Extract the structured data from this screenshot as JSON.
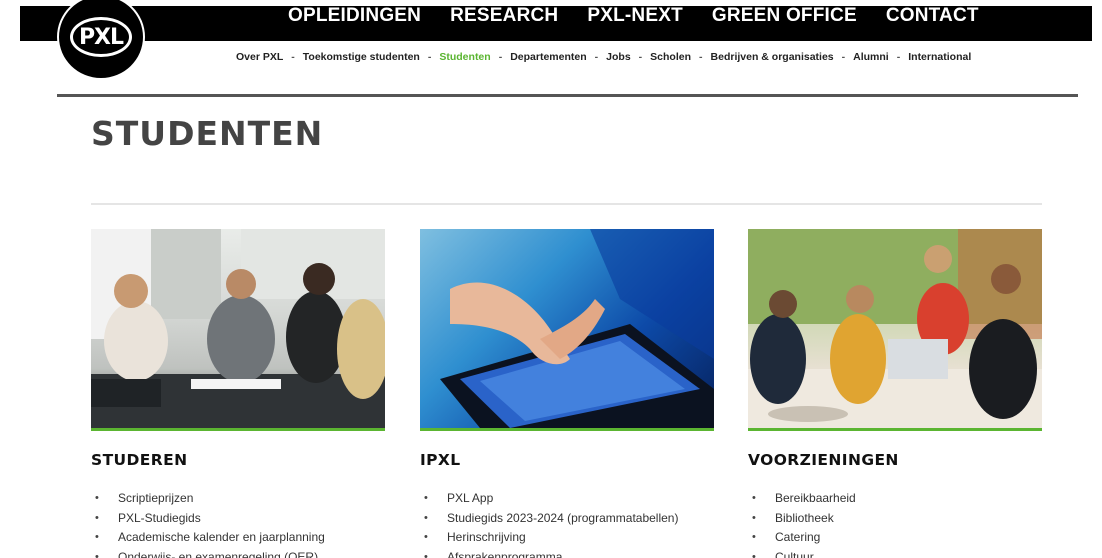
{
  "logo": {
    "text": "PXL"
  },
  "main_nav": [
    "OPLEIDINGEN",
    "RESEARCH",
    "PXL-NEXT",
    "GREEN OFFICE",
    "CONTACT"
  ],
  "sub_nav": [
    {
      "label": "Over PXL",
      "active": false
    },
    {
      "label": "Toekomstige studenten",
      "active": false
    },
    {
      "label": "Studenten",
      "active": true
    },
    {
      "label": "Departementen",
      "active": false
    },
    {
      "label": "Jobs",
      "active": false
    },
    {
      "label": "Scholen",
      "active": false
    },
    {
      "label": "Bedrijven & organisaties",
      "active": false
    },
    {
      "label": "Alumni",
      "active": false
    },
    {
      "label": "International",
      "active": false
    }
  ],
  "sub_nav_separator": "-",
  "page_title": "STUDENTEN",
  "colors": {
    "accent": "#5bb531",
    "topbar": "#000000",
    "title": "#444444"
  },
  "cards": [
    {
      "heading": "STUDEREN",
      "image": "students-studying-photo",
      "items": [
        "Scriptieprijzen",
        "PXL-Studiegids",
        "Academische kalender en jaarplanning",
        "Onderwijs- en examenregeling (OER)"
      ]
    },
    {
      "heading": "IPXL",
      "image": "tablet-photo",
      "items": [
        "PXL App",
        "Studiegids 2023-2024 (programmatabellen)",
        "Herinschrijving",
        "Afsprakenprogramma"
      ]
    },
    {
      "heading": "VOORZIENINGEN",
      "image": "students-lounge-photo",
      "items": [
        "Bereikbaarheid",
        "Bibliotheek",
        "Catering",
        "Cultuur"
      ]
    }
  ]
}
